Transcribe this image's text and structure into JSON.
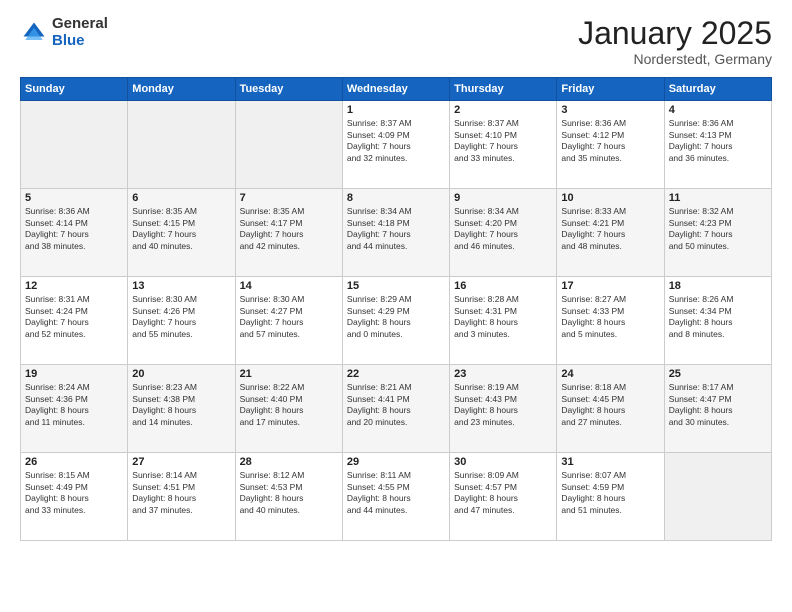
{
  "logo": {
    "general": "General",
    "blue": "Blue"
  },
  "title": {
    "main": "January 2025",
    "sub": "Norderstedt, Germany"
  },
  "headers": [
    "Sunday",
    "Monday",
    "Tuesday",
    "Wednesday",
    "Thursday",
    "Friday",
    "Saturday"
  ],
  "weeks": [
    [
      {
        "day": "",
        "info": ""
      },
      {
        "day": "",
        "info": ""
      },
      {
        "day": "",
        "info": ""
      },
      {
        "day": "1",
        "info": "Sunrise: 8:37 AM\nSunset: 4:09 PM\nDaylight: 7 hours\nand 32 minutes."
      },
      {
        "day": "2",
        "info": "Sunrise: 8:37 AM\nSunset: 4:10 PM\nDaylight: 7 hours\nand 33 minutes."
      },
      {
        "day": "3",
        "info": "Sunrise: 8:36 AM\nSunset: 4:12 PM\nDaylight: 7 hours\nand 35 minutes."
      },
      {
        "day": "4",
        "info": "Sunrise: 8:36 AM\nSunset: 4:13 PM\nDaylight: 7 hours\nand 36 minutes."
      }
    ],
    [
      {
        "day": "5",
        "info": "Sunrise: 8:36 AM\nSunset: 4:14 PM\nDaylight: 7 hours\nand 38 minutes."
      },
      {
        "day": "6",
        "info": "Sunrise: 8:35 AM\nSunset: 4:15 PM\nDaylight: 7 hours\nand 40 minutes."
      },
      {
        "day": "7",
        "info": "Sunrise: 8:35 AM\nSunset: 4:17 PM\nDaylight: 7 hours\nand 42 minutes."
      },
      {
        "day": "8",
        "info": "Sunrise: 8:34 AM\nSunset: 4:18 PM\nDaylight: 7 hours\nand 44 minutes."
      },
      {
        "day": "9",
        "info": "Sunrise: 8:34 AM\nSunset: 4:20 PM\nDaylight: 7 hours\nand 46 minutes."
      },
      {
        "day": "10",
        "info": "Sunrise: 8:33 AM\nSunset: 4:21 PM\nDaylight: 7 hours\nand 48 minutes."
      },
      {
        "day": "11",
        "info": "Sunrise: 8:32 AM\nSunset: 4:23 PM\nDaylight: 7 hours\nand 50 minutes."
      }
    ],
    [
      {
        "day": "12",
        "info": "Sunrise: 8:31 AM\nSunset: 4:24 PM\nDaylight: 7 hours\nand 52 minutes."
      },
      {
        "day": "13",
        "info": "Sunrise: 8:30 AM\nSunset: 4:26 PM\nDaylight: 7 hours\nand 55 minutes."
      },
      {
        "day": "14",
        "info": "Sunrise: 8:30 AM\nSunset: 4:27 PM\nDaylight: 7 hours\nand 57 minutes."
      },
      {
        "day": "15",
        "info": "Sunrise: 8:29 AM\nSunset: 4:29 PM\nDaylight: 8 hours\nand 0 minutes."
      },
      {
        "day": "16",
        "info": "Sunrise: 8:28 AM\nSunset: 4:31 PM\nDaylight: 8 hours\nand 3 minutes."
      },
      {
        "day": "17",
        "info": "Sunrise: 8:27 AM\nSunset: 4:33 PM\nDaylight: 8 hours\nand 5 minutes."
      },
      {
        "day": "18",
        "info": "Sunrise: 8:26 AM\nSunset: 4:34 PM\nDaylight: 8 hours\nand 8 minutes."
      }
    ],
    [
      {
        "day": "19",
        "info": "Sunrise: 8:24 AM\nSunset: 4:36 PM\nDaylight: 8 hours\nand 11 minutes."
      },
      {
        "day": "20",
        "info": "Sunrise: 8:23 AM\nSunset: 4:38 PM\nDaylight: 8 hours\nand 14 minutes."
      },
      {
        "day": "21",
        "info": "Sunrise: 8:22 AM\nSunset: 4:40 PM\nDaylight: 8 hours\nand 17 minutes."
      },
      {
        "day": "22",
        "info": "Sunrise: 8:21 AM\nSunset: 4:41 PM\nDaylight: 8 hours\nand 20 minutes."
      },
      {
        "day": "23",
        "info": "Sunrise: 8:19 AM\nSunset: 4:43 PM\nDaylight: 8 hours\nand 23 minutes."
      },
      {
        "day": "24",
        "info": "Sunrise: 8:18 AM\nSunset: 4:45 PM\nDaylight: 8 hours\nand 27 minutes."
      },
      {
        "day": "25",
        "info": "Sunrise: 8:17 AM\nSunset: 4:47 PM\nDaylight: 8 hours\nand 30 minutes."
      }
    ],
    [
      {
        "day": "26",
        "info": "Sunrise: 8:15 AM\nSunset: 4:49 PM\nDaylight: 8 hours\nand 33 minutes."
      },
      {
        "day": "27",
        "info": "Sunrise: 8:14 AM\nSunset: 4:51 PM\nDaylight: 8 hours\nand 37 minutes."
      },
      {
        "day": "28",
        "info": "Sunrise: 8:12 AM\nSunset: 4:53 PM\nDaylight: 8 hours\nand 40 minutes."
      },
      {
        "day": "29",
        "info": "Sunrise: 8:11 AM\nSunset: 4:55 PM\nDaylight: 8 hours\nand 44 minutes."
      },
      {
        "day": "30",
        "info": "Sunrise: 8:09 AM\nSunset: 4:57 PM\nDaylight: 8 hours\nand 47 minutes."
      },
      {
        "day": "31",
        "info": "Sunrise: 8:07 AM\nSunset: 4:59 PM\nDaylight: 8 hours\nand 51 minutes."
      },
      {
        "day": "",
        "info": ""
      }
    ]
  ]
}
